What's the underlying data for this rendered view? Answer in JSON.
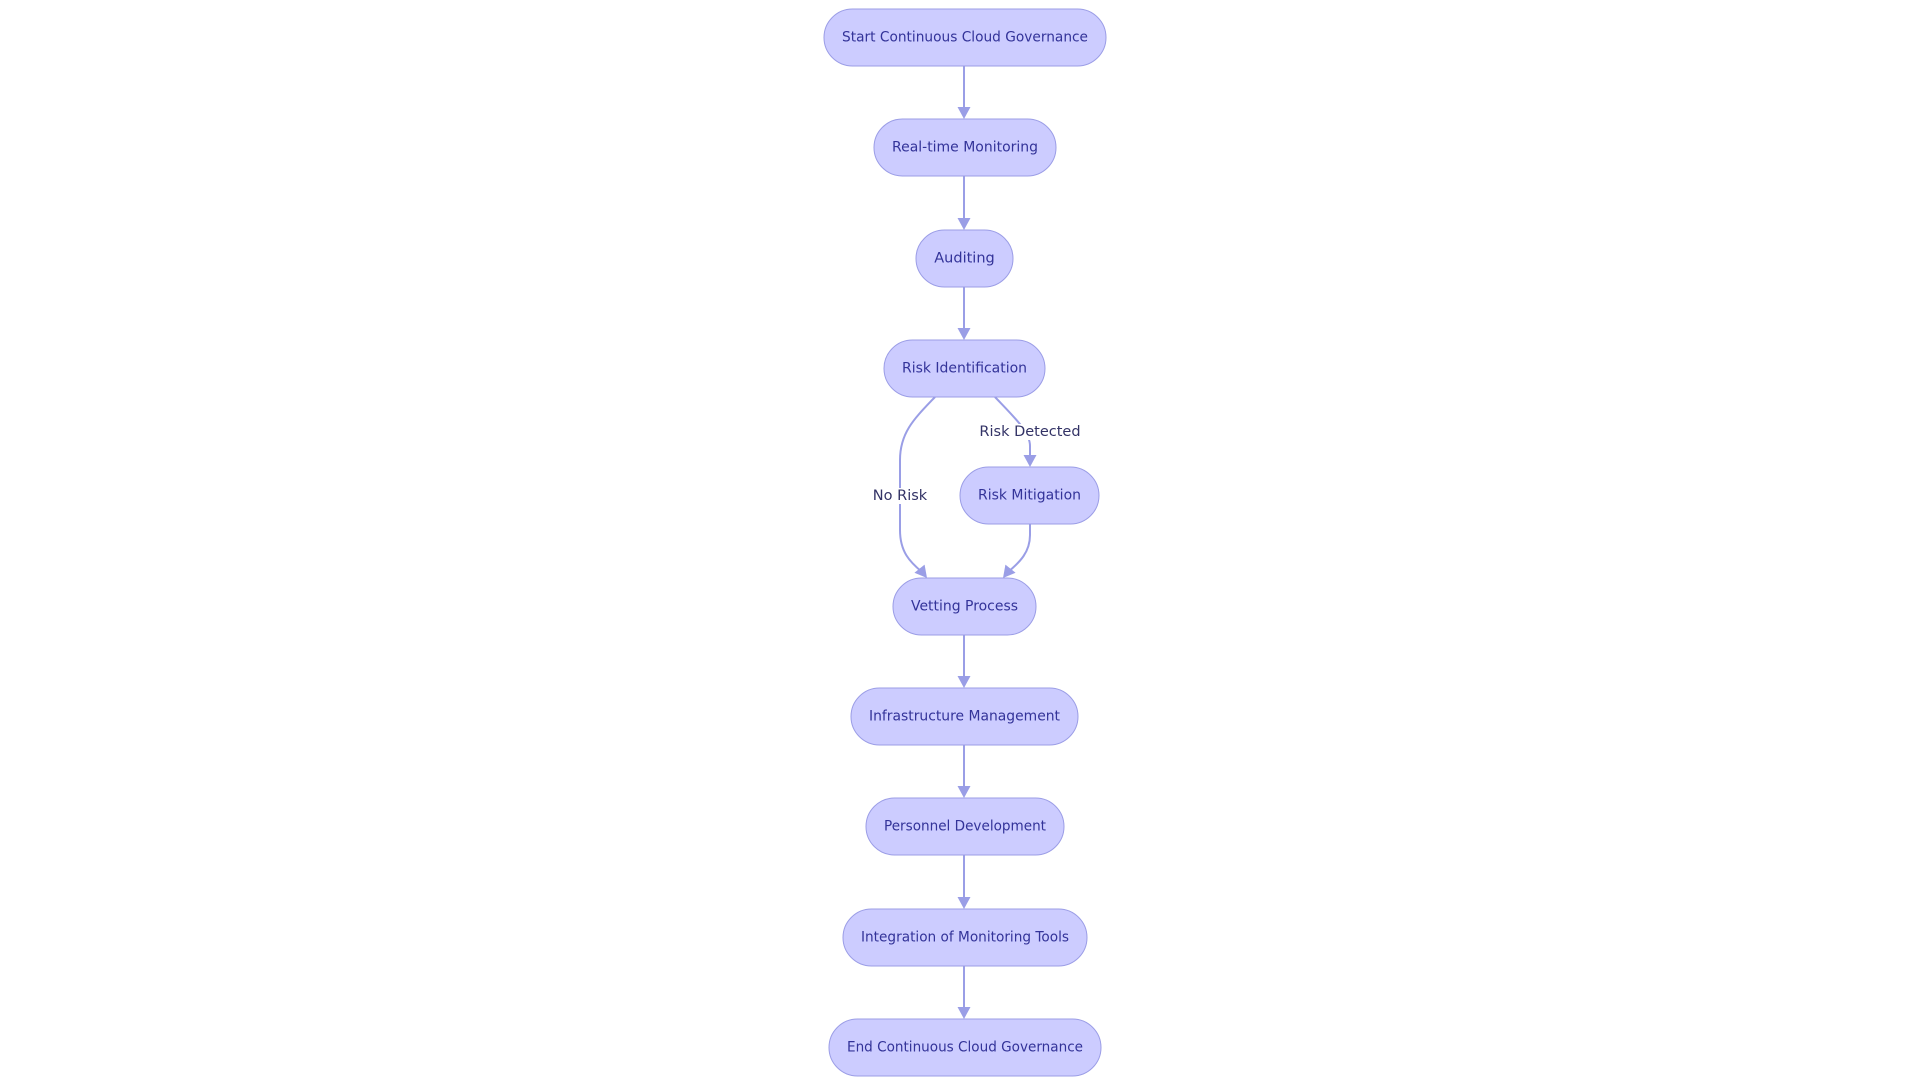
{
  "diagram": {
    "type": "flowchart",
    "colors": {
      "node_fill": "#ccccff",
      "node_stroke": "#9b9de6",
      "edge": "#9a9ee6",
      "text": "#333399"
    },
    "nodes": [
      {
        "id": "start",
        "label": "Start Continuous Cloud Governance"
      },
      {
        "id": "monitoring",
        "label": "Real-time Monitoring"
      },
      {
        "id": "auditing",
        "label": "Auditing"
      },
      {
        "id": "risk_id",
        "label": "Risk Identification"
      },
      {
        "id": "risk_mit",
        "label": "Risk Mitigation"
      },
      {
        "id": "vetting",
        "label": "Vetting Process"
      },
      {
        "id": "infra",
        "label": "Infrastructure Management"
      },
      {
        "id": "personnel",
        "label": "Personnel Development"
      },
      {
        "id": "integration",
        "label": "Integration of Monitoring Tools"
      },
      {
        "id": "end",
        "label": "End Continuous Cloud Governance"
      }
    ],
    "edges": [
      {
        "from": "start",
        "to": "monitoring",
        "label": ""
      },
      {
        "from": "monitoring",
        "to": "auditing",
        "label": ""
      },
      {
        "from": "auditing",
        "to": "risk_id",
        "label": ""
      },
      {
        "from": "risk_id",
        "to": "risk_mit",
        "label": "Risk Detected"
      },
      {
        "from": "risk_id",
        "to": "vetting",
        "label": "No Risk"
      },
      {
        "from": "risk_mit",
        "to": "vetting",
        "label": ""
      },
      {
        "from": "vetting",
        "to": "infra",
        "label": ""
      },
      {
        "from": "infra",
        "to": "personnel",
        "label": ""
      },
      {
        "from": "personnel",
        "to": "integration",
        "label": ""
      },
      {
        "from": "integration",
        "to": "end",
        "label": ""
      }
    ]
  }
}
